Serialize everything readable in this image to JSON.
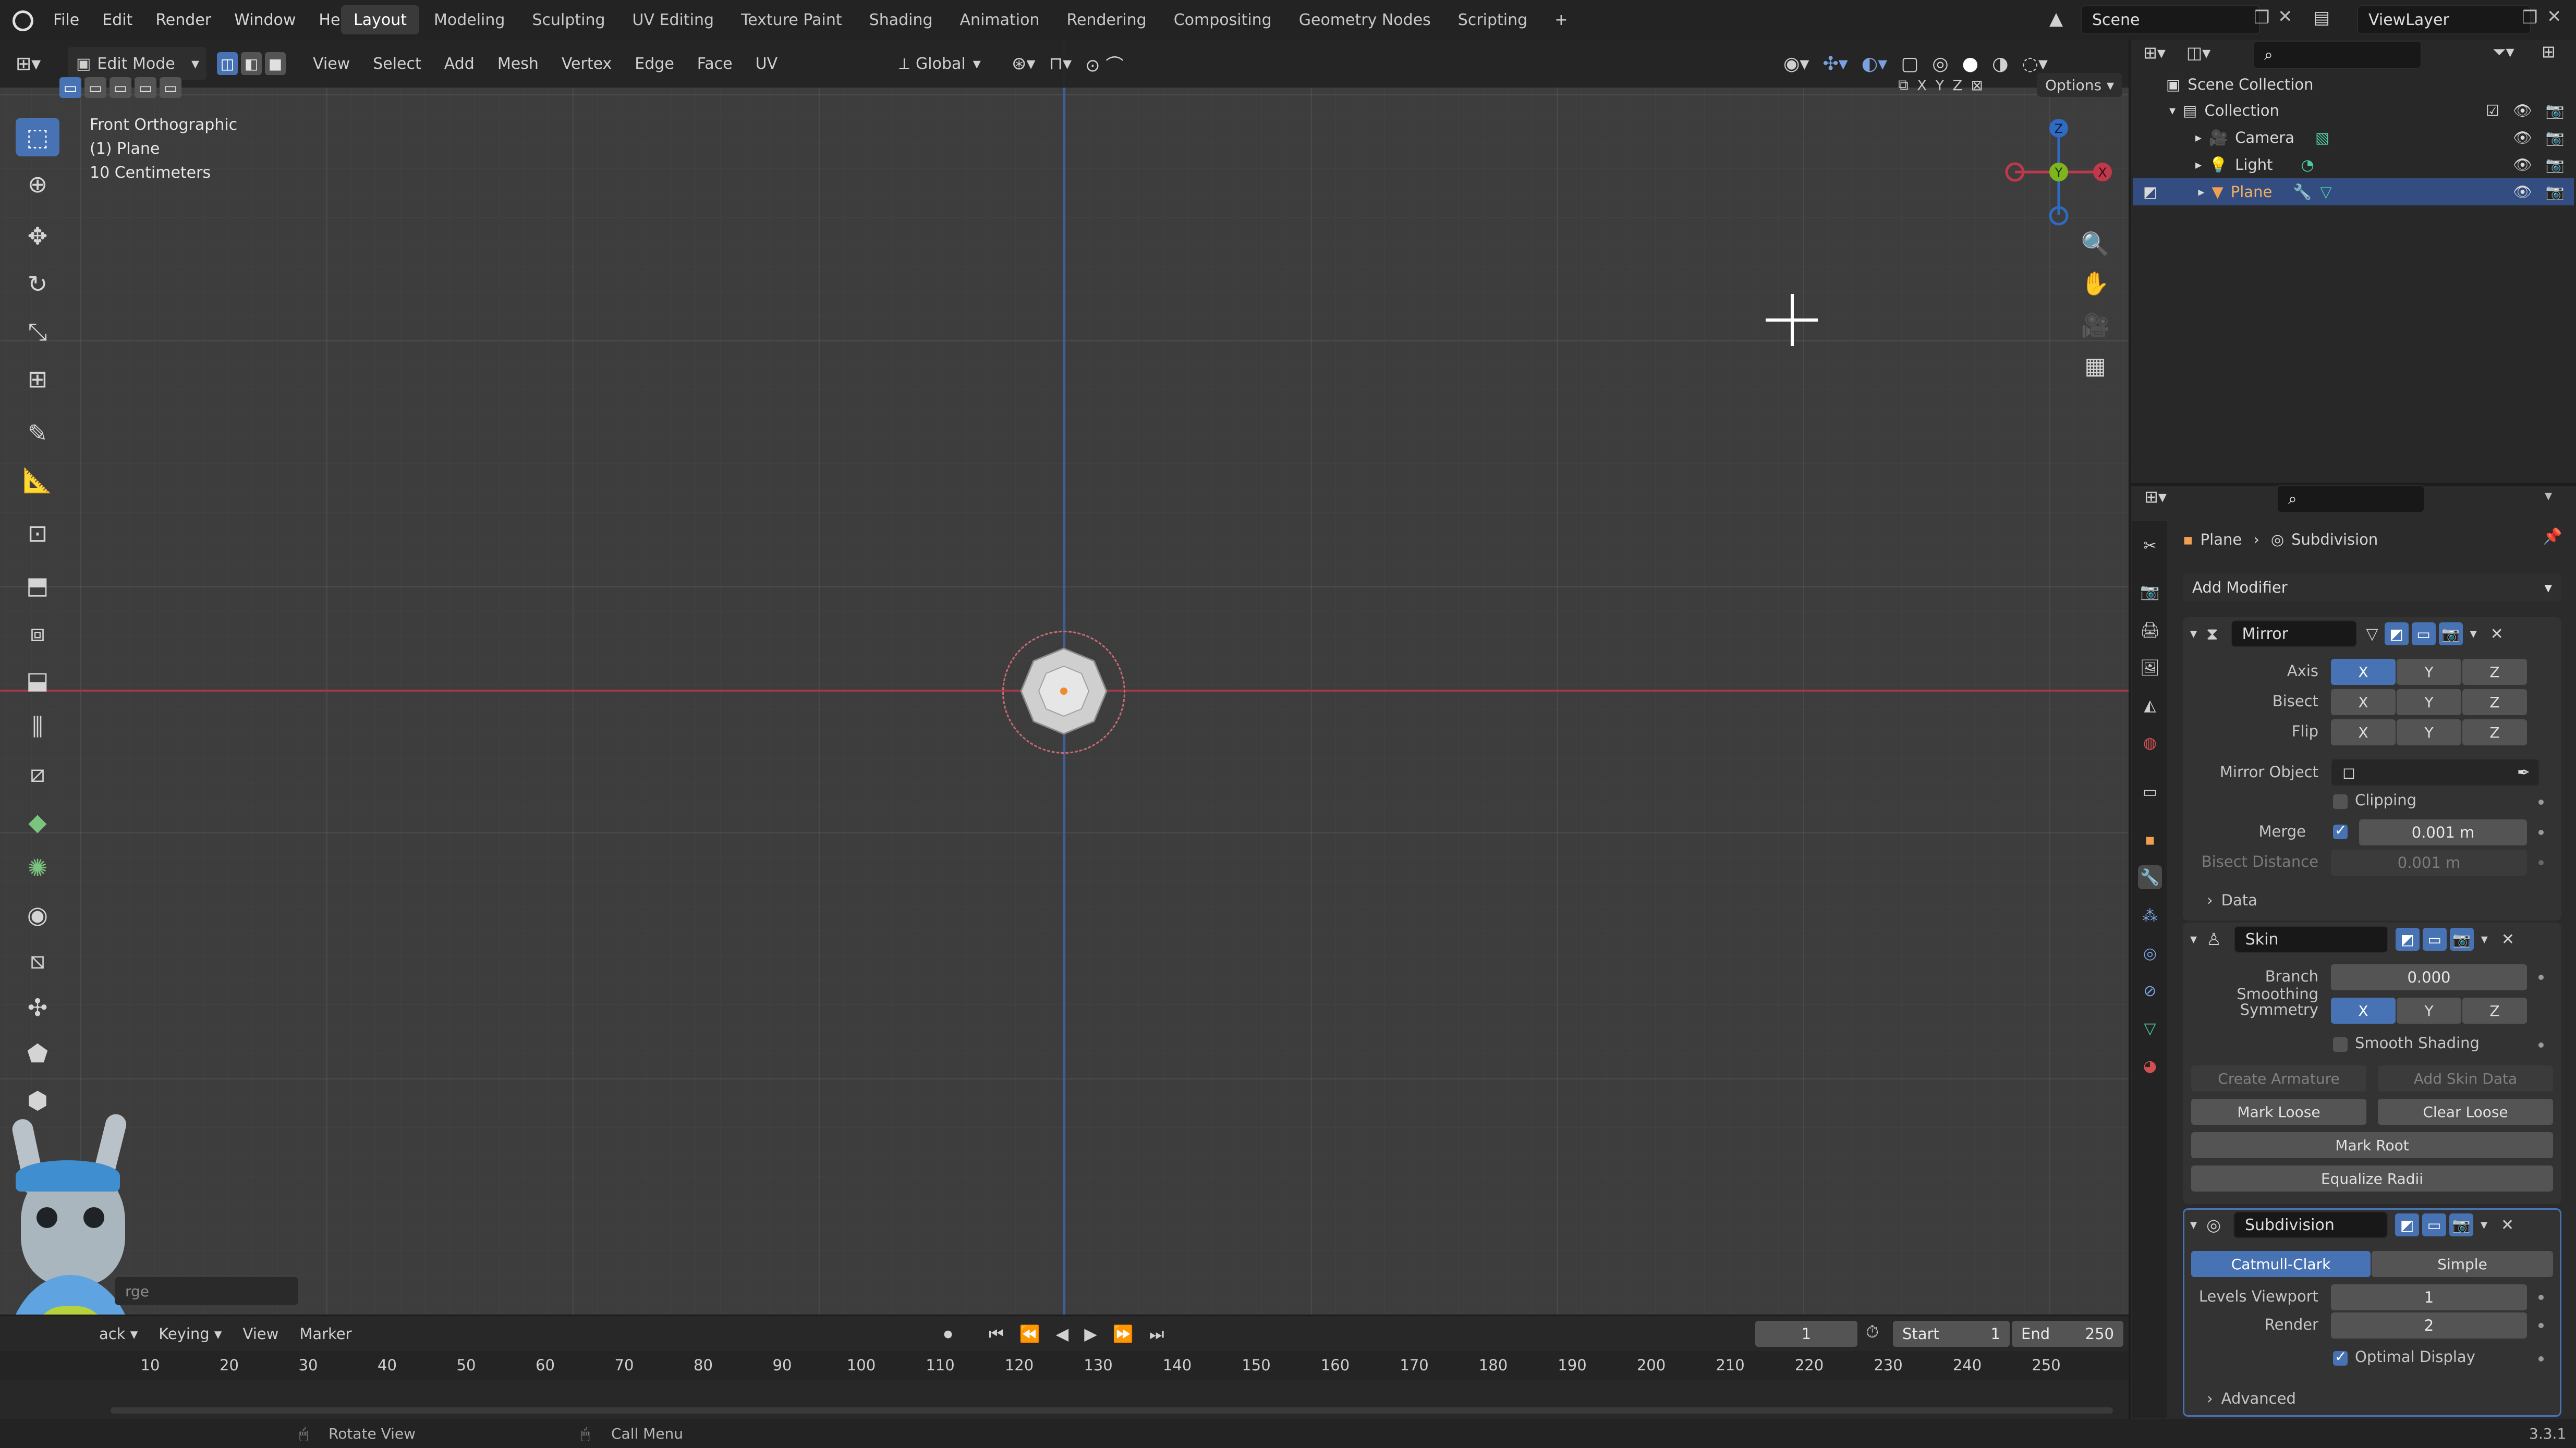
{
  "topbar": {
    "menu": [
      "File",
      "Edit",
      "Render",
      "Window",
      "Help"
    ],
    "workspaces": [
      "Layout",
      "Modeling",
      "Sculpting",
      "UV Editing",
      "Texture Paint",
      "Shading",
      "Animation",
      "Rendering",
      "Compositing",
      "Geometry Nodes",
      "Scripting"
    ],
    "active_workspace": "Layout",
    "add_tab": "+",
    "scene": "Scene",
    "view_layer": "ViewLayer"
  },
  "viewport_header": {
    "mode": "Edit Mode",
    "menus": [
      "View",
      "Select",
      "Add",
      "Mesh",
      "Vertex",
      "Edge",
      "Face",
      "UV"
    ],
    "transform_orientation": "Global",
    "axis_x": "X",
    "axis_y": "Y",
    "axis_z": "Z",
    "options": "Options"
  },
  "viewport_info": {
    "view": "Front Orthographic",
    "object": "(1) Plane",
    "scale": "10 Centimeters"
  },
  "gizmo": {
    "z": "Z",
    "y": "Y",
    "x": "X"
  },
  "outliner": {
    "scene_collection": "Scene Collection",
    "collection": "Collection",
    "items": [
      "Camera",
      "Light",
      "Plane"
    ],
    "selected": "Plane"
  },
  "properties": {
    "breadcrumb_object": "Plane",
    "breadcrumb_modifier": "Subdivision",
    "add_modifier": "Add Modifier",
    "mirror": {
      "name": "Mirror",
      "axis_label": "Axis",
      "bisect_label": "Bisect",
      "flip_label": "Flip",
      "x": "X",
      "y": "Y",
      "z": "Z",
      "mirror_object_label": "Mirror Object",
      "clipping_label": "Clipping",
      "merge_label": "Merge",
      "merge_value": "0.001 m",
      "bisect_distance_label": "Bisect Distance",
      "bisect_distance_value": "0.001 m",
      "data_label": "Data"
    },
    "skin": {
      "name": "Skin",
      "branch_smoothing_label": "Branch Smoothing",
      "branch_smoothing_value": "0.000",
      "symmetry_label": "Symmetry",
      "smooth_shading_label": "Smooth Shading",
      "create_armature": "Create Armature",
      "add_skin_data": "Add Skin Data",
      "mark_loose": "Mark Loose",
      "clear_loose": "Clear Loose",
      "mark_root": "Mark Root",
      "equalize_radii": "Equalize Radii"
    },
    "subdivision": {
      "name": "Subdivision",
      "catmull_clark": "Catmull-Clark",
      "simple": "Simple",
      "levels_viewport_label": "Levels Viewport",
      "levels_viewport_value": "1",
      "render_label": "Render",
      "render_value": "2",
      "optimal_display_label": "Optimal Display",
      "advanced_label": "Advanced"
    }
  },
  "timeline": {
    "menus": [
      "ack",
      "Keying",
      "View",
      "Marker"
    ],
    "partial_label": "rge",
    "current_frame": "1",
    "start_label": "Start",
    "start_value": "1",
    "end_label": "End",
    "end_value": "250",
    "ruler": [
      "10",
      "20",
      "30",
      "40",
      "50",
      "60",
      "70",
      "80",
      "90",
      "100",
      "110",
      "120",
      "130",
      "140",
      "150",
      "160",
      "170",
      "180",
      "190",
      "200",
      "210",
      "220",
      "230",
      "240",
      "250"
    ]
  },
  "statusbar": {
    "rotate_view": "Rotate View",
    "call_menu": "Call Menu",
    "version": "3.3.1"
  },
  "colors": {
    "accent": "#4772b3",
    "x_axis": "#c0394a",
    "y_axis": "#7db51e",
    "z_axis": "#2f6bc2",
    "viewport_bg": "#3d3d3d"
  }
}
